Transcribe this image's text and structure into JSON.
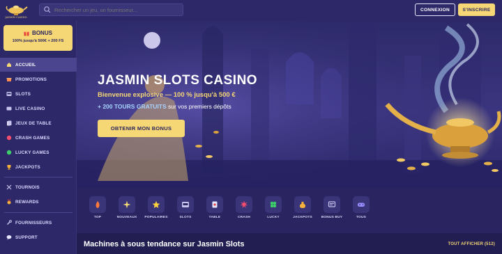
{
  "header": {
    "logo_text": "JASMIN CASINO",
    "search_placeholder": "Rechercher un jeu, un fournisseur...",
    "login_label": "CONNEXION",
    "signup_label": "S'INSCRIRE"
  },
  "sidebar": {
    "bonus": {
      "title": "BONUS",
      "subtitle": "100% jusqu'à 500€ + 200 FS"
    },
    "items": [
      {
        "label": "ACCUEIL",
        "icon": "home-icon",
        "active": true
      },
      {
        "label": "PROMOTIONS",
        "icon": "gift-icon"
      },
      {
        "label": "SLOTS",
        "icon": "slot-machine-icon"
      },
      {
        "label": "LIVE CASINO",
        "icon": "tv-icon"
      },
      {
        "label": "JEUX DE TABLE",
        "icon": "cards-icon"
      },
      {
        "label": "CRASH GAMES",
        "icon": "rocket-icon"
      },
      {
        "label": "LUCKY GAMES",
        "icon": "clover-icon"
      },
      {
        "label": "JACKPOTS",
        "icon": "trophy-icon"
      },
      {
        "label": "TOURNOIS",
        "icon": "crossed-swords-icon"
      },
      {
        "label": "REWARDS",
        "icon": "medal-icon"
      },
      {
        "label": "FOURNISSEURS",
        "icon": "wrench-icon"
      },
      {
        "label": "SUPPORT",
        "icon": "chat-icon"
      }
    ]
  },
  "hero": {
    "title": "JASMIN SLOTS CASINO",
    "line1": "Bienvenue explosive — 100 % jusqu'à 500 €",
    "line2_highlight": "+ 200 TOURS GRATUITS",
    "line2_rest": " sur vos premiers dépôts",
    "cta": "OBTENIR MON BONUS"
  },
  "categories": [
    {
      "label": "TOP",
      "icon": "flame-icon"
    },
    {
      "label": "NOUVEAUX",
      "icon": "sparkle-icon"
    },
    {
      "label": "POPULAIRES",
      "icon": "star-icon"
    },
    {
      "label": "SLOTS",
      "icon": "slot-machine-icon"
    },
    {
      "label": "TABLE",
      "icon": "cards-icon"
    },
    {
      "label": "CRASH",
      "icon": "explosion-icon"
    },
    {
      "label": "LUCKY",
      "icon": "clover-icon"
    },
    {
      "label": "JACKPOTS",
      "icon": "money-bag-icon"
    },
    {
      "label": "BONUS BUY",
      "icon": "cart-icon"
    },
    {
      "label": "TOUS",
      "icon": "gamepad-icon"
    }
  ],
  "trending": {
    "title": "Machines à sous tendance sur Jasmin Slots",
    "view_all": "TOUT AFFICHER (512)"
  },
  "colors": {
    "background": "#2a2560",
    "accent_gold": "#f5d775",
    "sidebar_active": "#4b4590"
  }
}
